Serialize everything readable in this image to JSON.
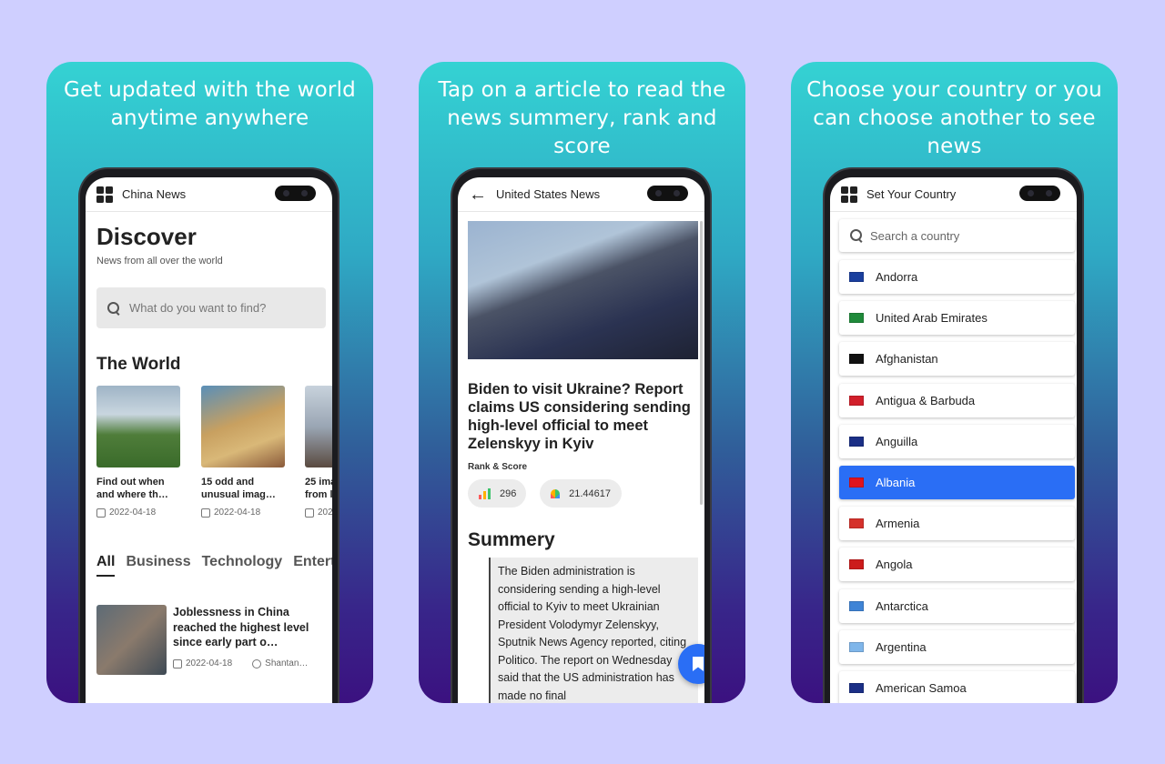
{
  "cards": [
    {
      "headline": "Get updated with the world anytime anywhere"
    },
    {
      "headline": "Tap on a article to read the news summery, rank and score"
    },
    {
      "headline": "Choose your country or you can choose another to see news"
    }
  ],
  "screen1": {
    "appbar_title": "China News",
    "heading": "Discover",
    "subheading": "News from all over the world",
    "search_placeholder": "What do you want to find?",
    "section_title": "The World",
    "tiles": [
      {
        "title": "Find out when and where th…",
        "title2": "and where th…",
        "date": "2022-04-18"
      },
      {
        "title": "15 odd and unusual imag…",
        "title2": "unusual imag…",
        "date": "2022-04-18"
      },
      {
        "title": "25 ima…",
        "title2": "from l…",
        "date": "202…"
      }
    ],
    "tabs": [
      "All",
      "Business",
      "Technology",
      "Entert"
    ],
    "article": {
      "title": "Joblessness in China reached the highest level since early part o…",
      "date": "2022-04-18",
      "source": "Shantan…"
    }
  },
  "screen2": {
    "appbar_title": "United States News",
    "headline": "Biden to visit Ukraine? Report claims US considering sending high-level official to meet Zelenskyy in Kyiv",
    "rank_label": "Rank & Score",
    "rank": "296",
    "score": "21.44617",
    "summary_title": "Summery",
    "summary_text": "The Biden administration is considering sending a high-level official to Kyiv to meet Ukrainian President Volodymyr Zelenskyy, Sputnik News Agency reported, citing Politico. The report on Wednesday said that the US administration has made no final"
  },
  "screen3": {
    "appbar_title": "Set Your Country",
    "search_placeholder": "Search a country",
    "countries": [
      {
        "name": "Andorra",
        "flag": "#1a3f9e"
      },
      {
        "name": "United Arab Emirates",
        "flag": "#1f8a3a"
      },
      {
        "name": "Afghanistan",
        "flag": "#111111"
      },
      {
        "name": "Antigua & Barbuda",
        "flag": "#d21f2b"
      },
      {
        "name": "Anguilla",
        "flag": "#1b2f86"
      },
      {
        "name": "Albania",
        "flag": "#e0141d",
        "selected": true
      },
      {
        "name": "Armenia",
        "flag": "#d5312b"
      },
      {
        "name": "Angola",
        "flag": "#cc1b1b"
      },
      {
        "name": "Antarctica",
        "flag": "#3f84d6"
      },
      {
        "name": "Argentina",
        "flag": "#7fb6ea"
      },
      {
        "name": "American Samoa",
        "flag": "#1b2f86"
      }
    ]
  },
  "colors": {
    "accent": "#2a6ef5",
    "background": "#cfcfff"
  }
}
